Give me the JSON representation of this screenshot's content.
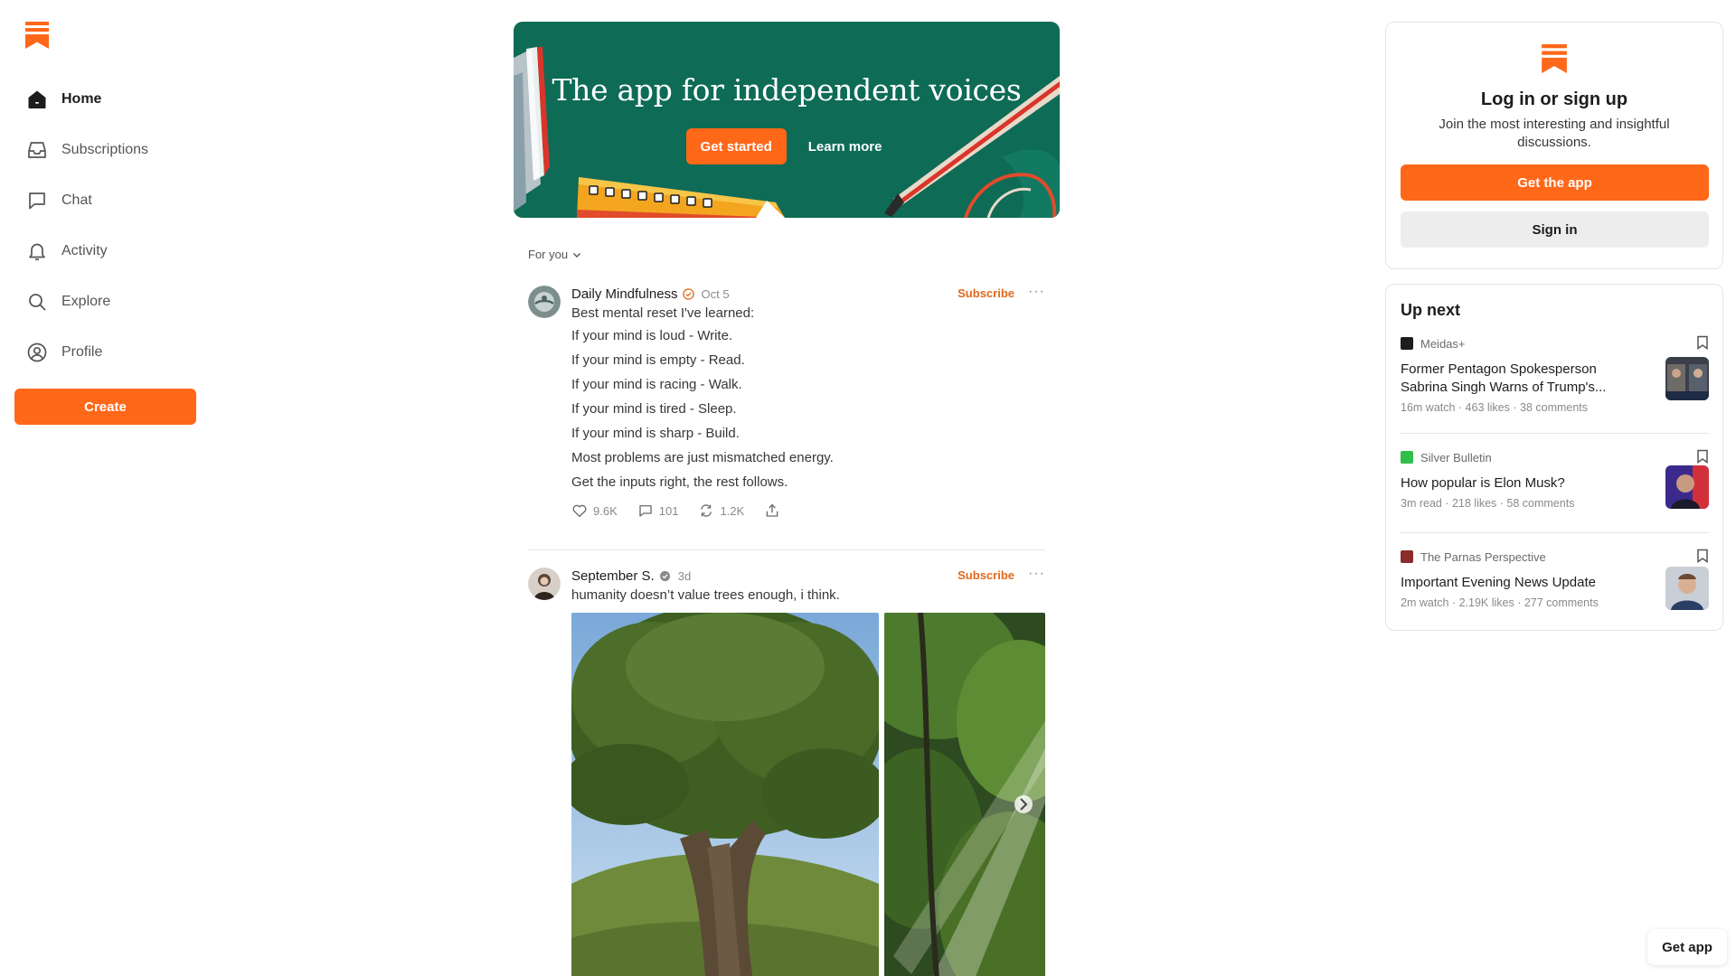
{
  "app": {
    "name": "Substack",
    "brand_color": "#ff6719"
  },
  "sidebar": {
    "items": [
      {
        "label": "Home",
        "icon": "home-icon",
        "active": true
      },
      {
        "label": "Subscriptions",
        "icon": "inbox-icon"
      },
      {
        "label": "Chat",
        "icon": "chat-icon"
      },
      {
        "label": "Activity",
        "icon": "bell-icon"
      },
      {
        "label": "Explore",
        "icon": "search-icon"
      },
      {
        "label": "Profile",
        "icon": "profile-icon"
      }
    ],
    "create_label": "Create"
  },
  "banner": {
    "title": "The app for independent voices",
    "get_started_label": "Get started",
    "learn_more_label": "Learn more",
    "background_color": "#0e6b56"
  },
  "feed": {
    "filter_label": "For you",
    "posts": [
      {
        "author": "Daily Mindfulness",
        "date": "Oct 5",
        "subscribe_label": "Subscribe",
        "lines": [
          "Best mental reset I've learned:",
          "If your mind is loud - Write.",
          "If your mind is empty - Read.",
          "If your mind is racing - Walk.",
          "If your mind is tired - Sleep.",
          "If your mind is sharp - Build.",
          "Most problems are just mismatched energy.",
          "Get the inputs right, the rest follows."
        ],
        "likes": "9.6K",
        "comments": "101",
        "restacks": "1.2K"
      },
      {
        "author": "September S.",
        "date": "3d",
        "subscribe_label": "Subscribe",
        "text": "humanity doesn’t value trees enough, i think."
      }
    ]
  },
  "login_card": {
    "title": "Log in or sign up",
    "subtitle": "Join the most interesting and insightful discussions.",
    "get_app_label": "Get the app",
    "sign_in_label": "Sign in"
  },
  "up_next": {
    "title": "Up next",
    "items": [
      {
        "publication": "Meidas+",
        "title": "Former Pentagon Spokesperson Sabrina Singh Warns of Trump's...",
        "meta": "16m watch · 463 likes · 38 comments"
      },
      {
        "publication": "Silver Bulletin",
        "title": "How popular is Elon Musk?",
        "meta": "3m read · 218 likes · 58 comments"
      },
      {
        "publication": "The Parnas Perspective",
        "title": "Important Evening News Update",
        "meta": "2m watch · 2.19K likes · 277 comments"
      }
    ]
  },
  "floating": {
    "get_app_label": "Get app"
  }
}
